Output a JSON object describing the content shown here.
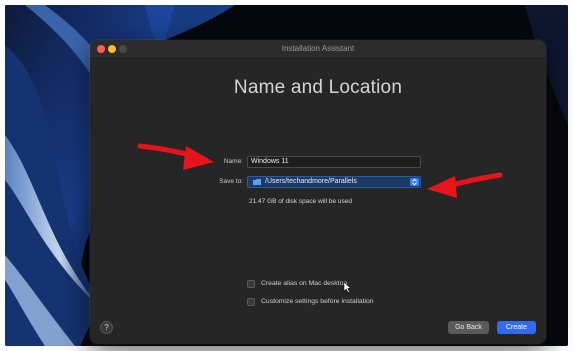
{
  "window": {
    "title": "Installation Assistant"
  },
  "page": {
    "heading": "Name and Location"
  },
  "form": {
    "name_label": "Name:",
    "name_value": "Windows 11",
    "save_label": "Save to:",
    "save_path": "/Users/techandmore/Parallels",
    "disk_info": "21.47 GB of disk space will be used"
  },
  "options": [
    {
      "label": "Create alias on Mac desktop",
      "checked": false
    },
    {
      "label": "Customize settings before installation",
      "checked": false
    }
  ],
  "buttons": {
    "help": "?",
    "go_back": "Go Back",
    "create": "Create"
  },
  "colors": {
    "accent": "#2f6cf0",
    "annotation_arrow": "#e8141c",
    "window_bg": "#262626"
  }
}
